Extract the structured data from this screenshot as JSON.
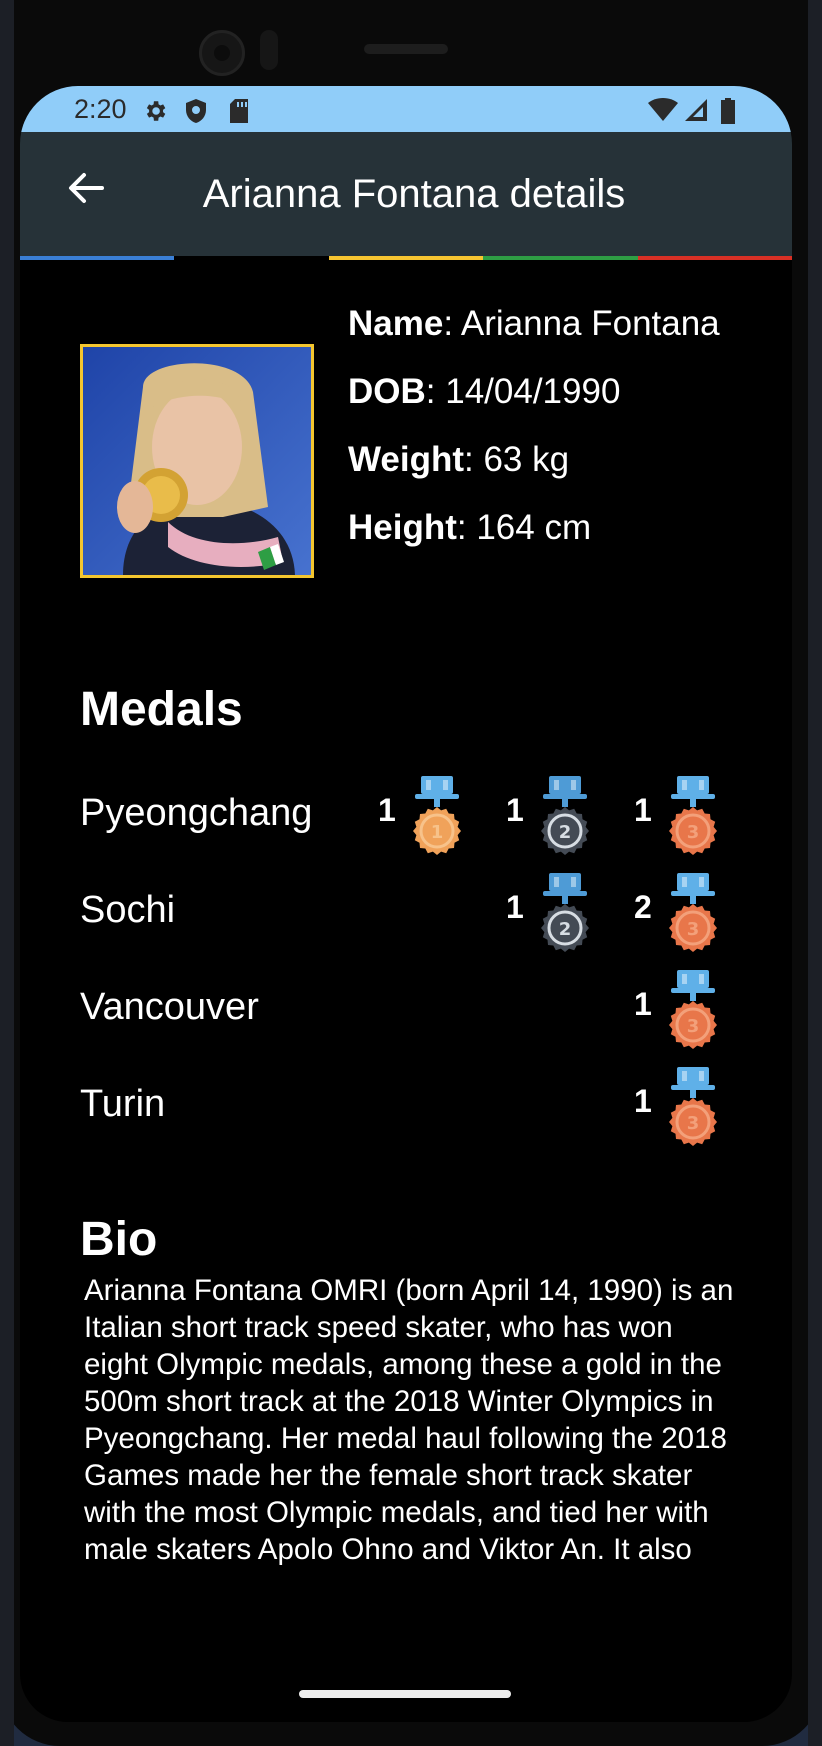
{
  "status_bar": {
    "time": "2:20"
  },
  "app_bar": {
    "title": "Arianna Fontana details"
  },
  "colors": {
    "app_bar": "#263238",
    "status_bar": "#90cdf9",
    "accent_frame": "#f4c62f",
    "rings": [
      "#3a7fd5",
      "#000000",
      "#f6c531",
      "#2e9e44",
      "#d93025"
    ]
  },
  "athlete": {
    "name_label": "Name",
    "name": "Arianna Fontana",
    "dob_label": "DOB",
    "dob": "14/04/1990",
    "weight_label": "Weight",
    "weight": "63 kg",
    "height_label": "Height",
    "height": "164 cm"
  },
  "medals": {
    "title": "Medals",
    "rows": [
      {
        "games": "Pyeongchang",
        "gold": "1",
        "silver": "1",
        "bronze": "1"
      },
      {
        "games": "Sochi",
        "gold": null,
        "silver": "1",
        "bronze": "2"
      },
      {
        "games": "Vancouver",
        "gold": null,
        "silver": null,
        "bronze": "1"
      },
      {
        "games": "Turin",
        "gold": null,
        "silver": null,
        "bronze": "1"
      }
    ]
  },
  "bio": {
    "title": "Bio",
    "text": "Arianna Fontana OMRI (born April 14, 1990) is an Italian short track speed skater, who has won eight Olympic medals, among these a gold in the 500m short track at the 2018 Winter Olympics in Pyeongchang. Her medal haul following the 2018 Games made her the female short track skater with the most Olympic medals, and tied her with male skaters Apolo Ohno and Viktor An. It also"
  }
}
